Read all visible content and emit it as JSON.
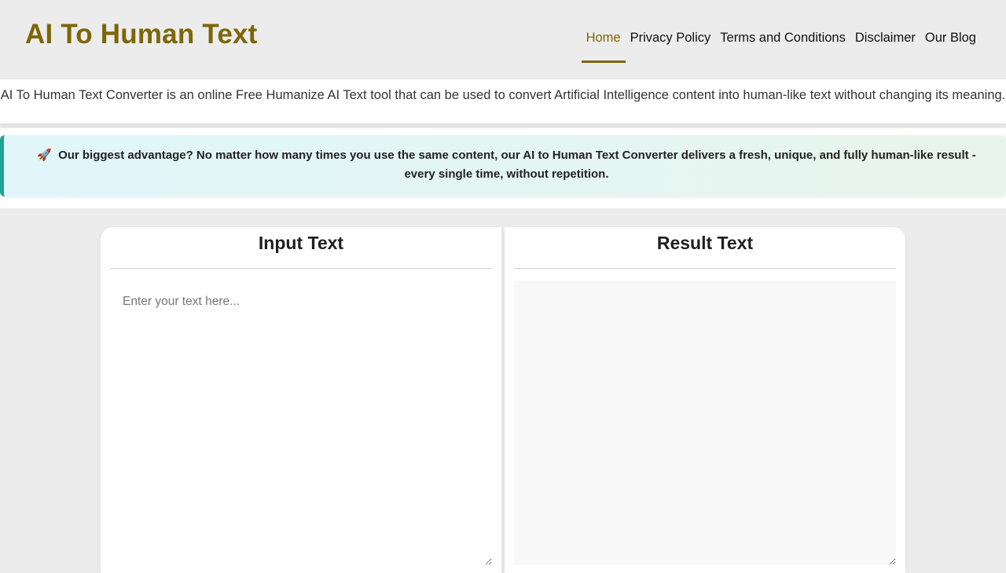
{
  "header": {
    "site_title": "AI To Human Text",
    "nav": [
      {
        "label": "Home",
        "active": true
      },
      {
        "label": "Privacy Policy",
        "active": false
      },
      {
        "label": "Terms and Conditions",
        "active": false
      },
      {
        "label": "Disclaimer",
        "active": false
      },
      {
        "label": "Our Blog",
        "active": false
      }
    ]
  },
  "intro": {
    "text": "AI To Human Text Converter is an online Free Humanize AI Text tool that can be used to convert Artificial Intelligence content into human-like text without changing its meaning."
  },
  "notice": {
    "icon": "rocket-icon",
    "icon_glyph": "🚀",
    "text": "Our biggest advantage? No matter how many times you use the same content, our AI to Human Text Converter delivers a fresh, unique, and fully human-like result - every single time, without repetition."
  },
  "editor": {
    "input_title": "Input Text",
    "input_placeholder": "Enter your text here...",
    "input_value": "",
    "result_title": "Result Text",
    "result_value": ""
  },
  "colors": {
    "brand": "#7d6608",
    "notice_border": "#1aa595",
    "page_bg": "#ececec"
  }
}
